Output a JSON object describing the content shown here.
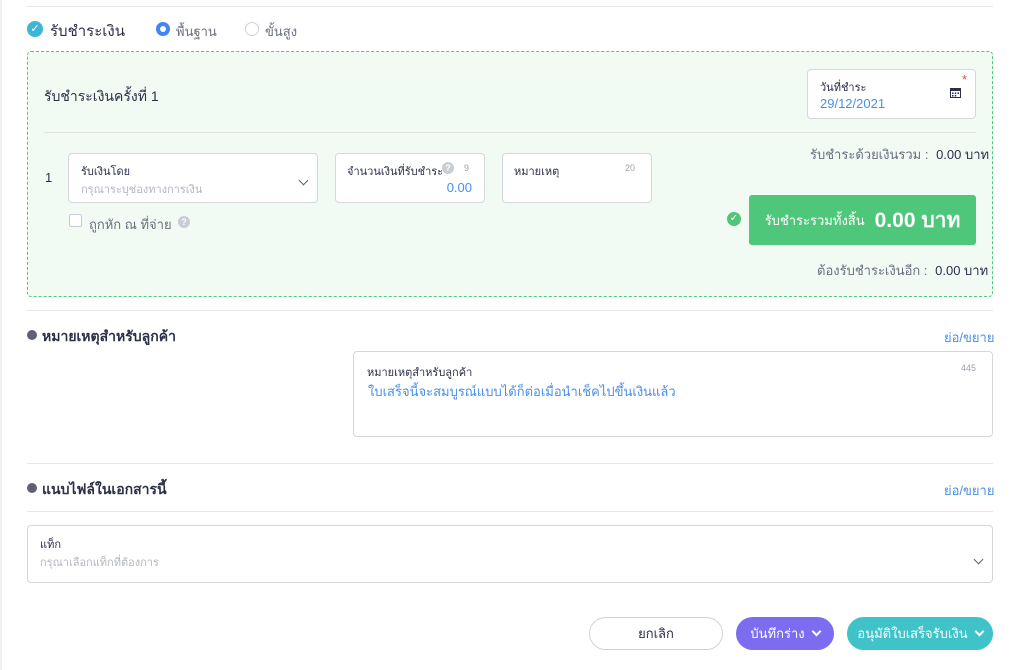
{
  "payment": {
    "title": "รับชำระเงิน",
    "mode_basic": "พื้นฐาน",
    "mode_advanced": "ขั้นสูง",
    "selected_mode": "พื้นฐาน"
  },
  "installment": {
    "title": "รับชำระเงินครั้งที่ 1",
    "date_label": "วันที่ชำระ",
    "date_value": "29/12/2021",
    "required_mark": "*",
    "row_number": "1",
    "method_label": "รับเงินโดย",
    "method_placeholder": "กรุณาระบุช่องทางการเงิน",
    "amount_label": "จำนวนเงินที่รับชำระ",
    "amount_count": "9",
    "amount_value": "0.00",
    "note_label": "หมายเหตุ",
    "note_count": "20",
    "withholding_label": "ถูกหัก ณ ที่จ่าย",
    "paid_by_cash_label": "รับชำระด้วยเงินรวม :",
    "paid_by_cash_value": "0.00 บาท",
    "total_label": "รับชำระรวมทั้งสิ้น",
    "total_value": "0.00 บาท",
    "remaining_label": "ต้องรับชำระเงินอีก :",
    "remaining_value": "0.00 บาท"
  },
  "customer_note": {
    "title": "หมายเหตุสำหรับลูกค้า",
    "toggle": "ย่อ/ขยาย",
    "field_label": "หมายเหตุสำหรับลูกค้า",
    "field_count": "445",
    "field_value": "ใบเสร็จนี้จะสมบูรณ์แบบได้ก็ต่อเมื่อนำเช็คไปขึ้นเงินแล้ว"
  },
  "attachments": {
    "title": "แนบไฟล์ในเอกสารนี้",
    "toggle": "ย่อ/ขยาย",
    "tag_label": "แท็ก",
    "tag_placeholder": "กรุณาเลือกแท็กที่ต้องการ"
  },
  "actions": {
    "cancel": "ยกเลิก",
    "save_draft": "บันทึกร่าง",
    "approve": "อนุมัติใบเสร็จรับเงิน"
  },
  "colors": {
    "accent_blue": "#4a8fe7",
    "success_green": "#4ec77a",
    "draft_purple": "#7b6cf0",
    "approve_teal": "#3fc3c9"
  }
}
